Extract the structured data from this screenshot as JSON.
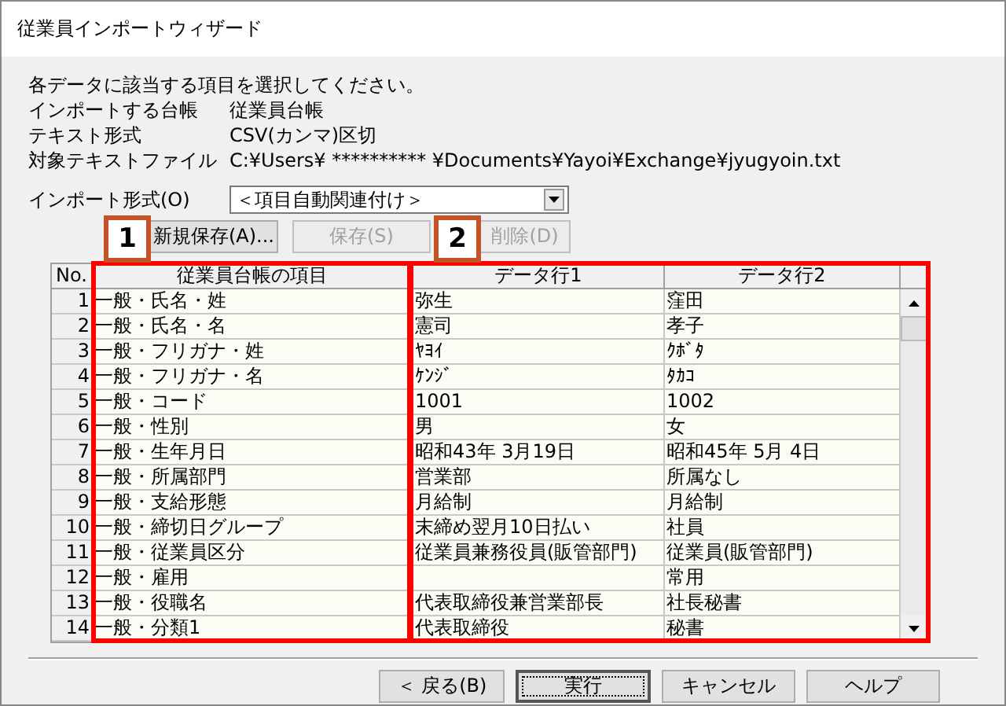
{
  "window": {
    "title": "従業員インポートウィザード"
  },
  "instruction": "各データに該当する項目を選択してください。",
  "info": [
    {
      "label": "インポートする台帳",
      "value": "従業員台帳"
    },
    {
      "label": "テキスト形式",
      "value": "CSV(カンマ)区切"
    },
    {
      "label": "対象テキストファイル",
      "value": "C:¥Users¥ ********** ¥Documents¥Yayoi¥Exchange¥jyugyoin.txt"
    }
  ],
  "import_format": {
    "label": "インポート形式(O)",
    "value": "＜項目自動関連付け＞"
  },
  "toolbar": [
    {
      "label": "新規保存(A)...",
      "disabled": false
    },
    {
      "label": "保存(S)",
      "disabled": true
    },
    {
      "label": "削除(D)",
      "disabled": true
    }
  ],
  "callouts": [
    "1",
    "2"
  ],
  "table": {
    "columns": [
      "No.",
      "従業員台帳の項目",
      "データ行1",
      "データ行2"
    ],
    "rows": [
      {
        "no": "1",
        "item": "一般・氏名・姓",
        "data_1": "弥生",
        "data_2": "窪田"
      },
      {
        "no": "2",
        "item": "一般・氏名・名",
        "data_1": "憲司",
        "data_2": "孝子"
      },
      {
        "no": "3",
        "item": "一般・フリガナ・姓",
        "data_1": "ﾔﾖｲ",
        "data_2": "ｸﾎﾞﾀ"
      },
      {
        "no": "4",
        "item": "一般・フリガナ・名",
        "data_1": "ｹﾝｼﾞ",
        "data_2": "ﾀｶｺ"
      },
      {
        "no": "5",
        "item": "一般・コード",
        "data_1": "1001",
        "data_2": "1002"
      },
      {
        "no": "6",
        "item": "一般・性別",
        "data_1": "男",
        "data_2": "女"
      },
      {
        "no": "7",
        "item": "一般・生年月日",
        "data_1": "昭和43年 3月19日",
        "data_2": "昭和45年 5月 4日"
      },
      {
        "no": "8",
        "item": "一般・所属部門",
        "data_1": "営業部",
        "data_2": "所属なし"
      },
      {
        "no": "9",
        "item": "一般・支給形態",
        "data_1": "月給制",
        "data_2": "月給制"
      },
      {
        "no": "10",
        "item": "一般・締切日グループ",
        "data_1": "末締め翌月10日払い",
        "data_2": "社員"
      },
      {
        "no": "11",
        "item": "一般・従業員区分",
        "data_1": "従業員兼務役員(販管部門)",
        "data_2": "従業員(販管部門)"
      },
      {
        "no": "12",
        "item": "一般・雇用",
        "data_2": "常用"
      },
      {
        "no": "13",
        "item": "一般・役職名",
        "data_1": "代表取締役兼営業部長",
        "data_2": "社長秘書"
      },
      {
        "no": "14",
        "item": "一般・分類1",
        "data_1": "代表取締役",
        "data_2": "秘書"
      }
    ]
  },
  "footer_buttons": [
    {
      "label": "＜ 戻る(B)",
      "default": false
    },
    {
      "label": "実行",
      "default": true
    },
    {
      "label": "キャンセル",
      "default": false
    },
    {
      "label": "ヘルプ",
      "default": false
    }
  ]
}
